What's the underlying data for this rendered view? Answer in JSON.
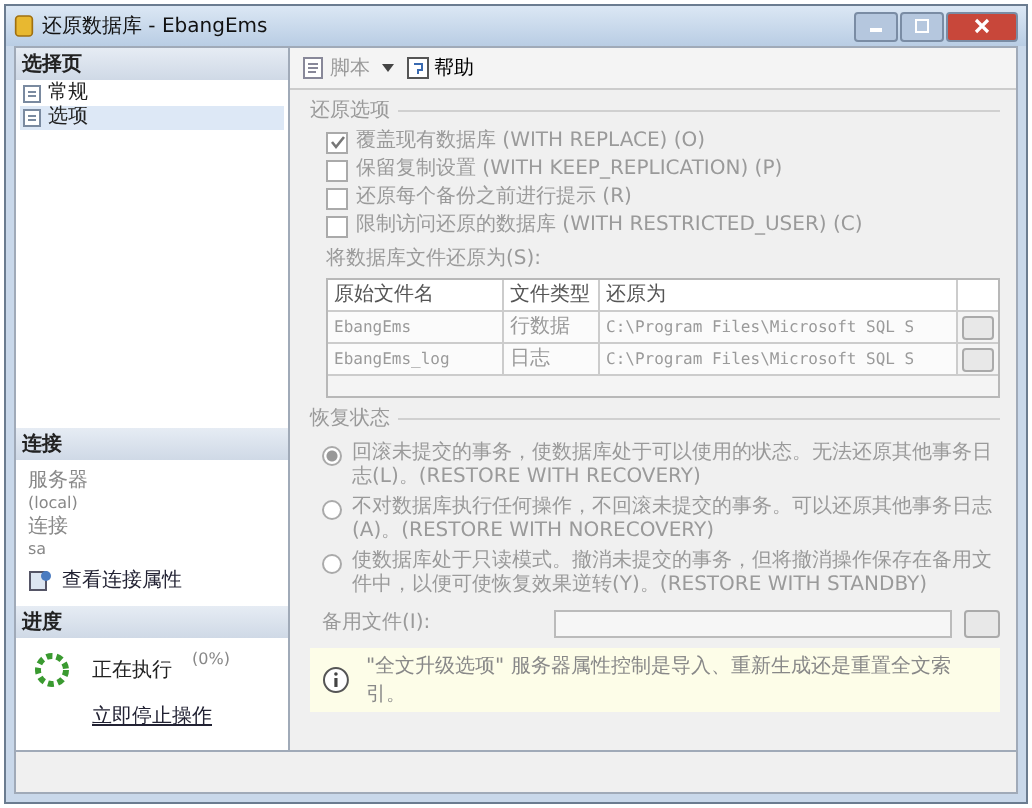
{
  "window": {
    "title": "还原数据库 - EbangEms"
  },
  "sidebar": {
    "header": "选择页",
    "items": [
      {
        "label": "常规",
        "selected": false
      },
      {
        "label": "选项",
        "selected": true
      }
    ]
  },
  "connection": {
    "header": "连接",
    "server_label": "服务器",
    "server": "(local)",
    "login_label": "连接",
    "login": "sa",
    "link": "查看连接属性"
  },
  "progress": {
    "header": "进度",
    "status": "正在执行",
    "percent": "(0%)",
    "link": "立即停止操作"
  },
  "toolbar": {
    "items": [
      {
        "label": "脚本",
        "kind": "dropdown"
      },
      {
        "label": "帮助",
        "kind": "help"
      }
    ]
  },
  "restore_options": {
    "title": "还原选项",
    "checkboxes": [
      {
        "label": "覆盖现有数据库 (WITH REPLACE) (O)",
        "checked": true
      },
      {
        "label": "保留复制设置 (WITH KEEP_REPLICATION) (P)",
        "checked": false
      },
      {
        "label": "还原每个备份之前进行提示 (R)",
        "checked": false
      },
      {
        "label": "限制访问还原的数据库 (WITH RESTRICTED_USER) (C)",
        "checked": false
      }
    ]
  },
  "files": {
    "label": "将数据库文件还原为(S):",
    "columns": [
      "原始文件名",
      "文件类型",
      "还原为"
    ],
    "rows": [
      [
        "EbangEms",
        "行数据",
        "C:\\Program Files\\Microsoft SQL S"
      ],
      [
        "EbangEms_log",
        "日志",
        "C:\\Program Files\\Microsoft SQL S"
      ]
    ]
  },
  "recovery": {
    "title": "恢复状态",
    "options": [
      {
        "label": "回滚未提交的事务，使数据库处于可以使用的状态。无法还原其他事务日志(L)。(RESTORE WITH RECOVERY)",
        "selected": true
      },
      {
        "label": "不对数据库执行任何操作，不回滚未提交的事务。可以还原其他事务日志(A)。(RESTORE WITH NORECOVERY)",
        "selected": false
      },
      {
        "label": "使数据库处于只读模式。撤消未提交的事务，但将撤消操作保存在备用文件中，以便可使恢复效果逆转(Y)。(RESTORE WITH STANDBY)",
        "selected": false
      }
    ],
    "standby_label": "备用文件(I):"
  },
  "info": "\"全文升级选项\" 服务器属性控制是导入、重新生成还是重置全文索引。"
}
